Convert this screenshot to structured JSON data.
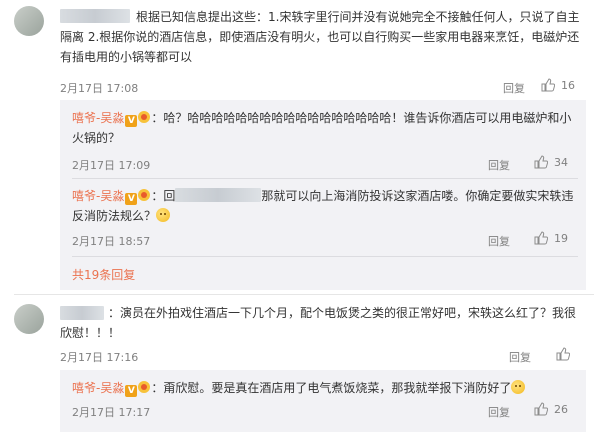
{
  "comment1": {
    "text": "根据已知信息提出这些：1.宋轶字里行间并没有说她完全不接触任何人，只说了自主隔离 2.根据你说的酒店信息，即使酒店没有明火，也可以自行购买一些家用电器来烹饪，电磁炉还有插电用的小锅等都可以",
    "time": "2月17日 17:08",
    "reply_label": "回复",
    "likes": "16",
    "replies": [
      {
        "name": "嘻爷-吴淼",
        "text": "：哈？哈哈哈哈哈哈哈哈哈哈哈哈哈哈哈哈哈！谁告诉你酒店可以用电磁炉和小火锅的？",
        "time": "2月17日 17:09",
        "reply_label": "回复",
        "likes": "34"
      },
      {
        "name": "嘻爷-吴淼",
        "text_prefix": "：回",
        "text": "那就可以向上海消防投诉这家酒店喽。你确定要做实宋轶违反消防法规么？",
        "time": "2月17日 18:57",
        "reply_label": "回复",
        "likes": "19"
      }
    ],
    "more_replies": "共19条回复"
  },
  "comment2": {
    "text": "：演员在外拍戏住酒店一下几个月，配个电饭煲之类的很正常好吧，宋轶这么红了？我很欣慰！！！",
    "time": "2月17日 17:16",
    "reply_label": "回复",
    "likes": "",
    "replies": [
      {
        "name": "嘻爷-吴淼",
        "text": "：甭欣慰。要是真在酒店用了电气煮饭烧菜，那我就举报下消防好了",
        "time": "2月17日 17:17",
        "reply_label": "回复",
        "likes": "26"
      }
    ]
  },
  "colors": {
    "name": "#eb7350",
    "meta": "#808080",
    "reply_bg": "#f2f2f5"
  },
  "icons": {
    "like": "thumbs-up-icon",
    "vip": "vip-badge-icon",
    "medal": "medal-badge-icon",
    "emoji": "emoji-icon"
  }
}
